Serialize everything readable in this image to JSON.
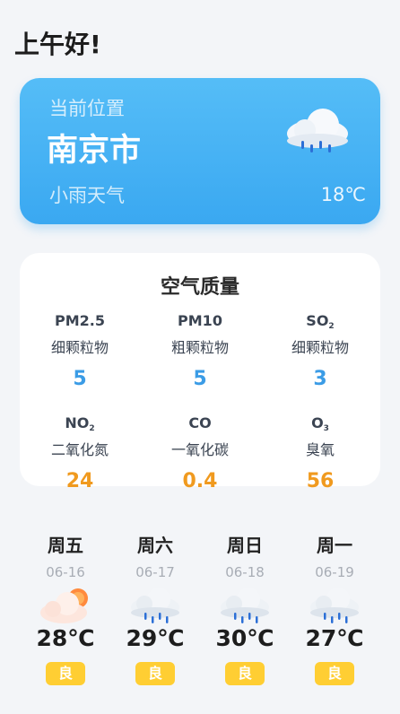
{
  "greeting": "上午好!",
  "location": {
    "label": "当前位置",
    "city": "南京市",
    "weather": "小雨天气",
    "temp": "18℃",
    "icon": "rain-cloud-icon"
  },
  "air": {
    "title": "空气质量",
    "items": [
      {
        "name": "PM2.5",
        "sub": "",
        "desc": "细颗粒物",
        "value": "5",
        "color": "#3b9ce6"
      },
      {
        "name": "PM10",
        "sub": "",
        "desc": "粗颗粒物",
        "value": "5",
        "color": "#3b9ce6"
      },
      {
        "name": "SO",
        "sub": "2",
        "desc": "细颗粒物",
        "value": "3",
        "color": "#3b9ce6"
      },
      {
        "name": "NO",
        "sub": "2",
        "desc": "二氧化氮",
        "value": "24",
        "color": "#f09a1f"
      },
      {
        "name": "CO",
        "sub": "",
        "desc": "一氧化碳",
        "value": "0.4",
        "color": "#f09a1f"
      },
      {
        "name": "O",
        "sub": "3",
        "desc": "臭氧",
        "value": "56",
        "color": "#f09a1f"
      }
    ]
  },
  "forecast": [
    {
      "day": "周五",
      "date": "06-16",
      "icon": "sun-cloud-icon",
      "temp": "28℃",
      "quality": "良"
    },
    {
      "day": "周六",
      "date": "06-17",
      "icon": "rain-cloud-icon",
      "temp": "29℃",
      "quality": "良"
    },
    {
      "day": "周日",
      "date": "06-18",
      "icon": "rain-cloud-icon",
      "temp": "30℃",
      "quality": "良"
    },
    {
      "day": "周一",
      "date": "06-19",
      "icon": "rain-cloud-icon",
      "temp": "27℃",
      "quality": "良"
    }
  ],
  "colors": {
    "card_blue": "#3aa8f1",
    "value_blue": "#3b9ce6",
    "value_orange": "#f09a1f",
    "badge_yellow": "#ffce33"
  }
}
